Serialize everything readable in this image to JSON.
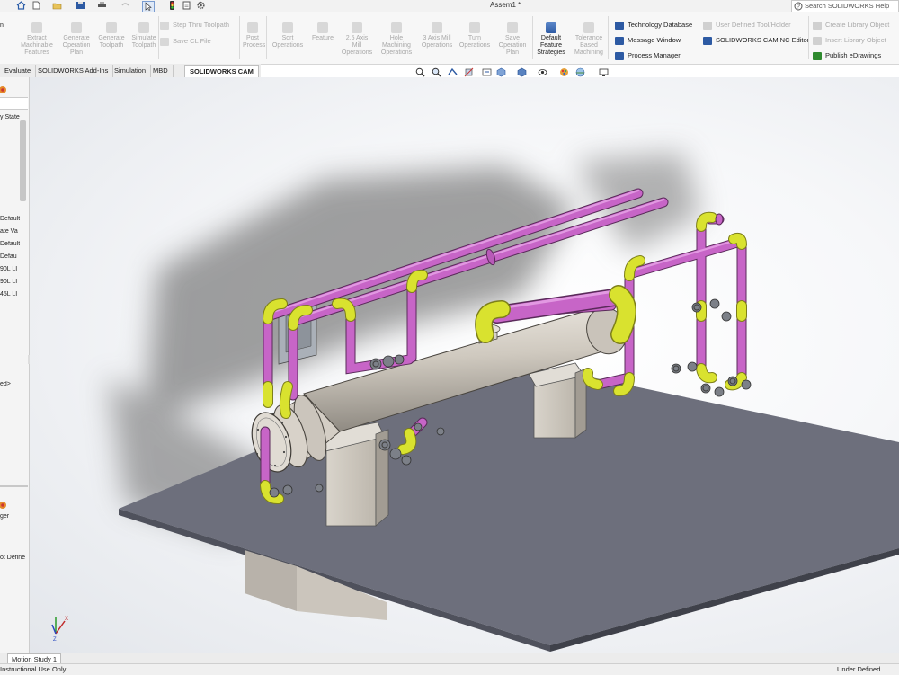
{
  "title_bar": {
    "document": "Assem1 *",
    "search_placeholder": "Search SOLIDWORKS Help"
  },
  "ribbon": {
    "buttons": [
      {
        "label": "Extract Machinable Features",
        "lines": [
          "Extract",
          "Machinable",
          "Features"
        ],
        "enabled": false
      },
      {
        "label": "Generate Operation Plan",
        "lines": [
          "Generate",
          "Operation",
          "Plan"
        ],
        "enabled": false
      },
      {
        "label": "Generate Toolpath",
        "lines": [
          "Generate",
          "Toolpath"
        ],
        "enabled": false
      },
      {
        "label": "Simulate Toolpath",
        "lines": [
          "Simulate",
          "Toolpath"
        ],
        "enabled": false
      },
      {
        "label": "Step Thru Toolpath",
        "enabled": false
      },
      {
        "label": "Save CL File",
        "enabled": false
      },
      {
        "label": "Post Process",
        "lines": [
          "Post",
          "Process"
        ],
        "enabled": false
      },
      {
        "label": "Sort Operations",
        "lines": [
          "Sort",
          "Operations"
        ],
        "enabled": false
      },
      {
        "label": "Feature",
        "lines": [
          "Feature"
        ],
        "enabled": false
      },
      {
        "label": "2.5 Axis Mill Operations",
        "lines": [
          "2.5 Axis",
          "Mill",
          "Operations"
        ],
        "enabled": false
      },
      {
        "label": "Hole Machining Operations",
        "lines": [
          "Hole",
          "Machining",
          "Operations"
        ],
        "enabled": false
      },
      {
        "label": "3 Axis Mill Operations",
        "lines": [
          "3 Axis Mill",
          "Operations"
        ],
        "enabled": false
      },
      {
        "label": "Turn Operations",
        "lines": [
          "Turn",
          "Operations"
        ],
        "enabled": false
      },
      {
        "label": "Save Operation Plan",
        "lines": [
          "Save",
          "Operation",
          "Plan"
        ],
        "enabled": false
      },
      {
        "label": "Default Feature Strategies",
        "lines": [
          "Default",
          "Feature",
          "Strategies"
        ],
        "enabled": true
      },
      {
        "label": "Tolerance Based Machining",
        "lines": [
          "Tolerance",
          "Based",
          "Machining"
        ],
        "enabled": false
      }
    ],
    "list_col1": [
      "Technology Database",
      "Message Window",
      "Process Manager"
    ],
    "list_col2": [
      "User Defined Tool/Holder",
      "SOLIDWORKS CAM NC Editor"
    ],
    "list_col3": [
      "Create Library Object",
      "Insert Library Object",
      "Publish eDrawings"
    ]
  },
  "tabs": [
    "Evaluate",
    "SOLIDWORKS Add-Ins",
    "Simulation",
    "MBD",
    "SOLIDWORKS CAM"
  ],
  "selected_tab": "SOLIDWORKS CAM",
  "left_panel": {
    "upper_items": [
      "y State",
      "Default",
      "ate Va",
      "Default",
      "Defau",
      "90L LI",
      "90L LI",
      "45L LI",
      "ed>"
    ],
    "lower_items": [
      "ger",
      "ot Define"
    ]
  },
  "bottom": {
    "motion_tab": "Motion Study 1",
    "status_left": "Instructional Use Only",
    "status_right": "Under Defined"
  },
  "colors": {
    "pipe_magenta": "#c765c7",
    "pipe_yellow": "#d9e22f",
    "vessel": "#cfc9bf",
    "floor_plate": "#6d6f7c",
    "active_icon": "#3b6db5"
  }
}
